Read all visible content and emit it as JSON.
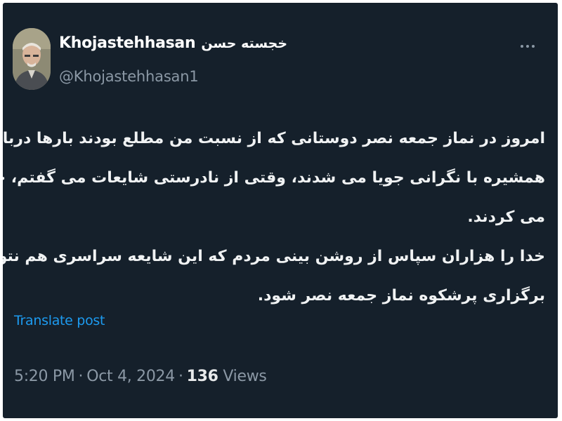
{
  "author": {
    "display_name_latin": "Khojastehhasan",
    "display_name_persian": "خجسته حسن",
    "handle": "@Khojastehhasan1"
  },
  "post": {
    "lines": [
      "امروز در نماز جمعه نصر دوستانی که از نسبت من مطلع بودند بارها درباره حال",
      "همشیره با نگرانی جویا می شدند، وقتی از نادرستی شایعات می گفتم، خدا را شکر",
      "می کردند.",
      "خدا را هزاران سپاس از روشن بینی مردم که این شایعه سراسری هم نتوانست مانع",
      "برگزاری پرشکوه  نماز جمعه نصر شود."
    ],
    "translate_label": "Translate post"
  },
  "meta": {
    "time": "5:20 PM",
    "date": "Oct 4, 2024",
    "views_count": "136",
    "views_label": "Views",
    "separator": "·"
  },
  "icons": {
    "more": "more-horizontal-icon"
  },
  "colors": {
    "background": "#15202b",
    "text": "#e7e9ea",
    "secondary": "#8b98a5",
    "link": "#1d9bf0"
  }
}
